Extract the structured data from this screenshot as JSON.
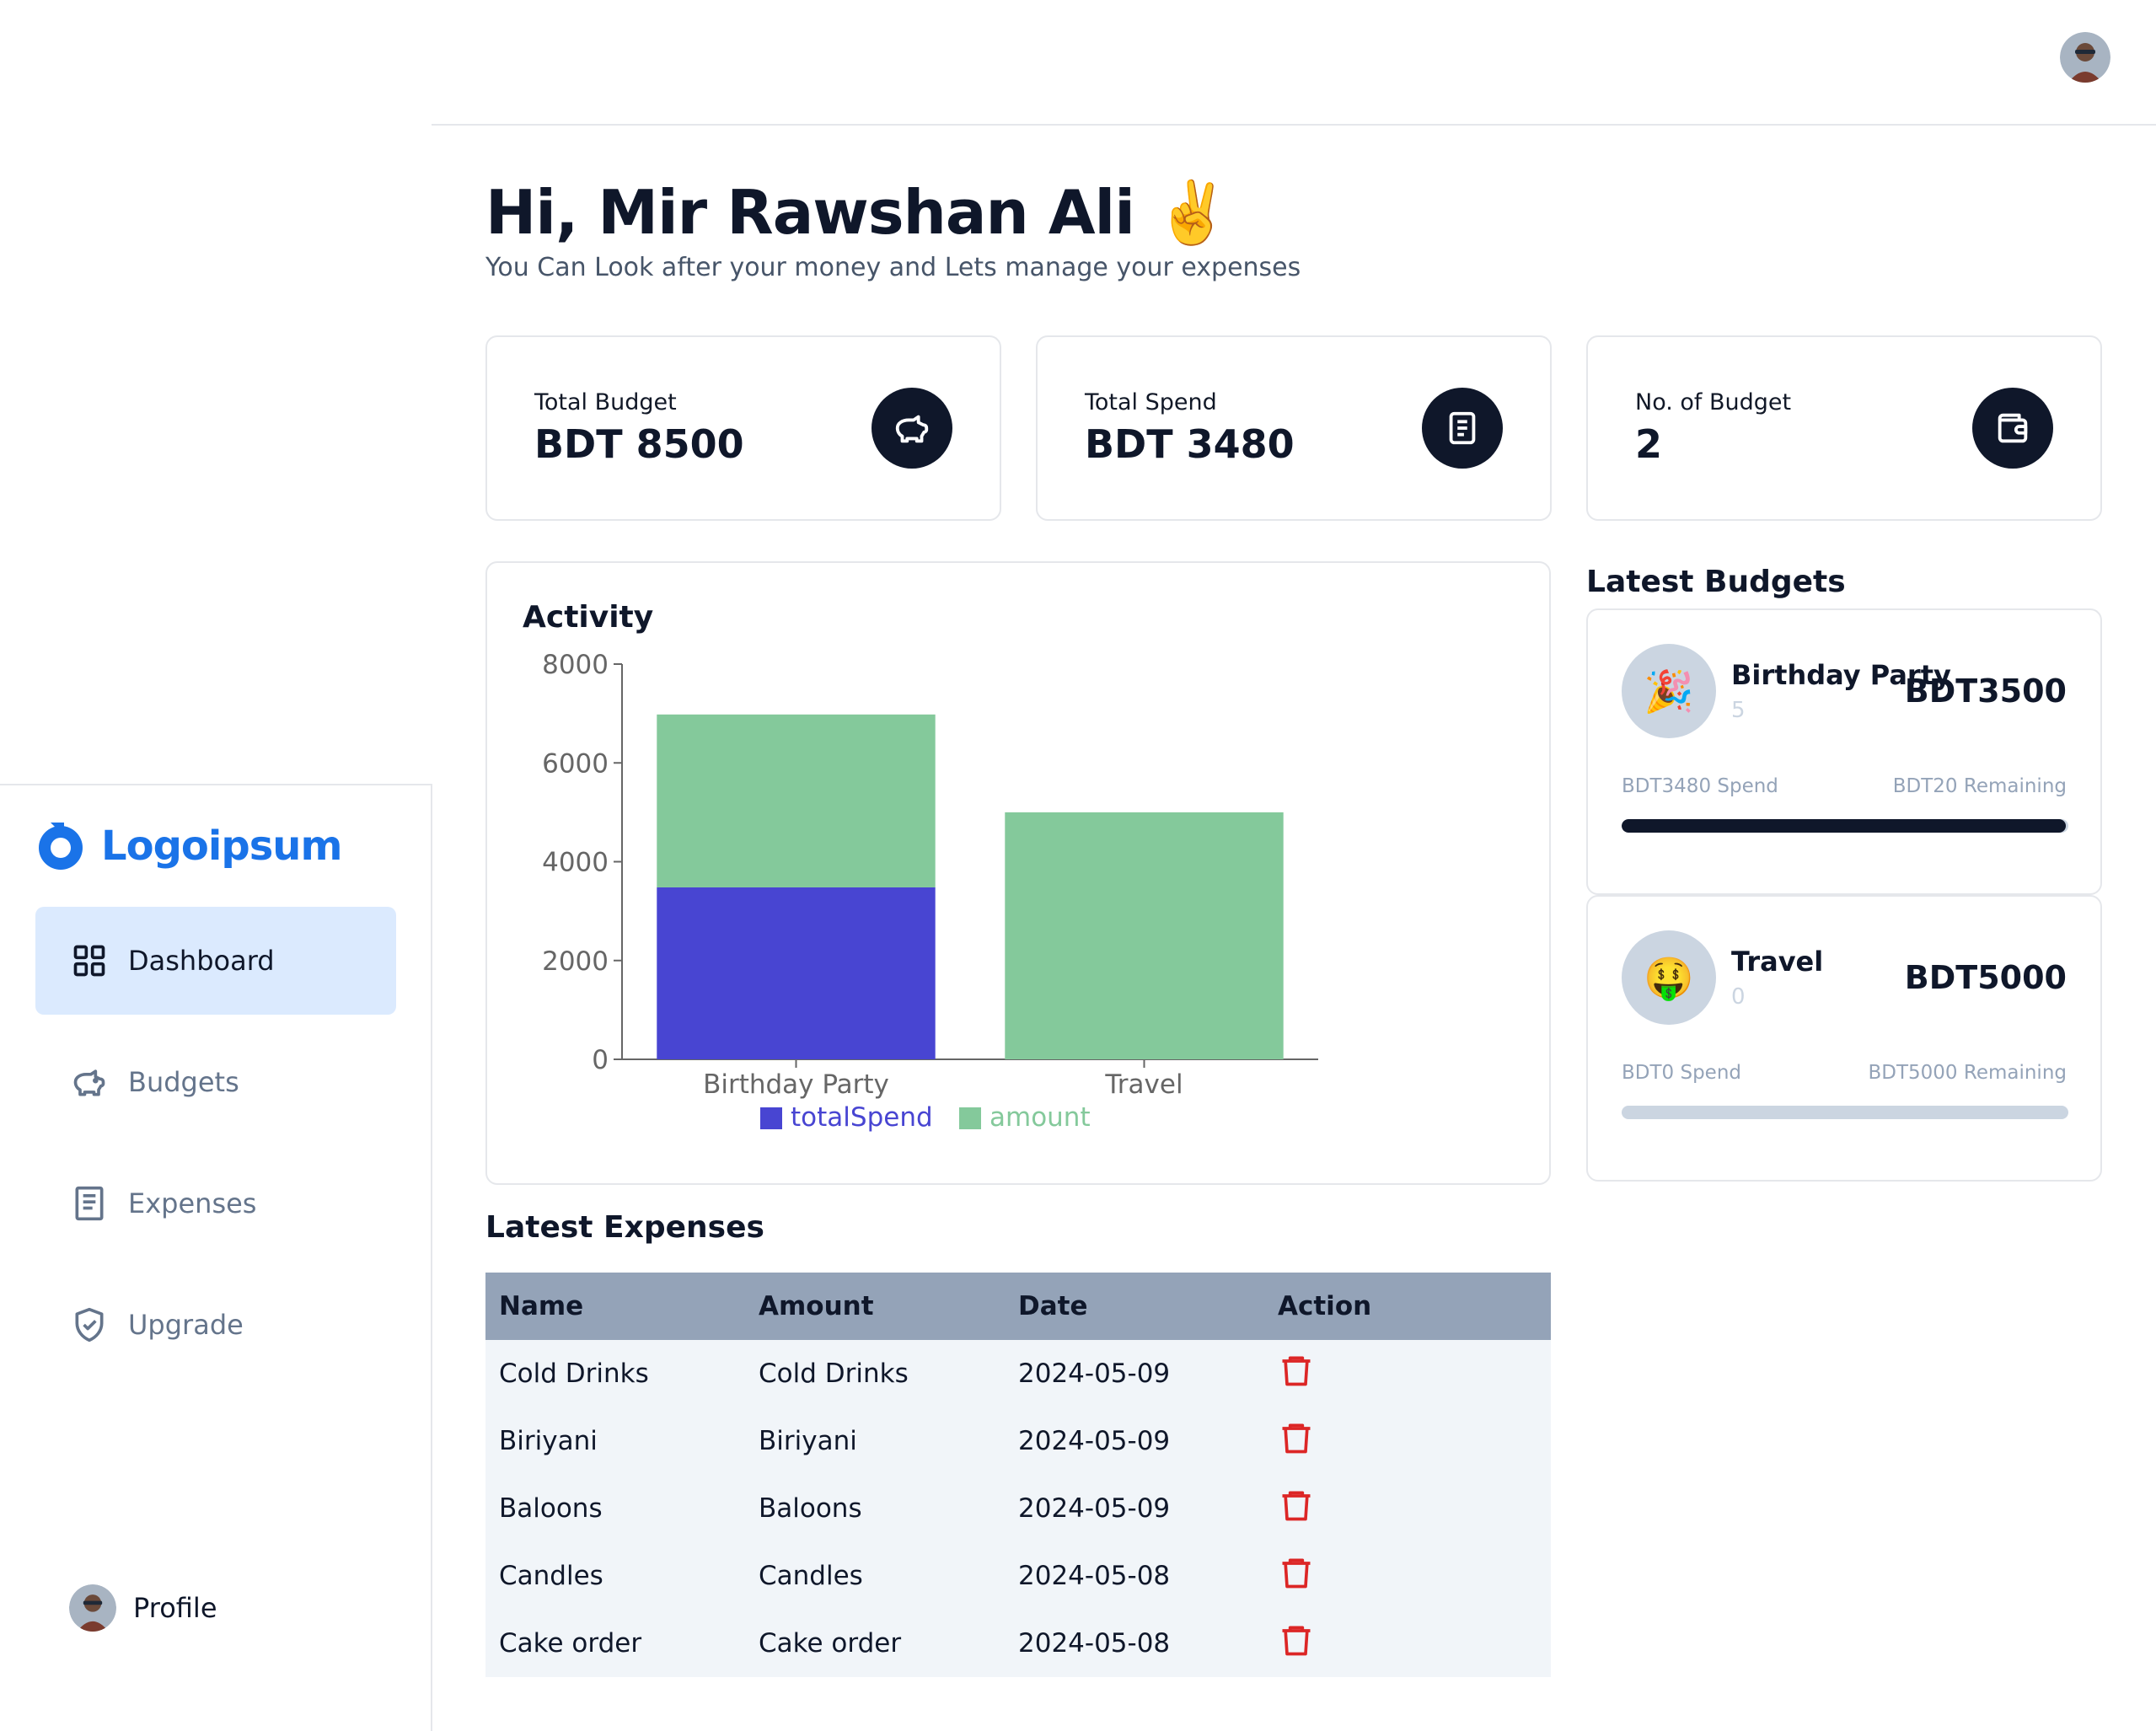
{
  "header": {
    "avatar_icon": "user-avatar"
  },
  "sidebar": {
    "logo_text": "Logoipsum",
    "brand_color": "#1a73e8",
    "items": [
      {
        "label": "Dashboard",
        "icon": "layout-grid-icon",
        "active": true
      },
      {
        "label": "Budgets",
        "icon": "piggy-bank-icon",
        "active": false
      },
      {
        "label": "Expenses",
        "icon": "receipt-icon",
        "active": false
      },
      {
        "label": "Upgrade",
        "icon": "shield-check-icon",
        "active": false
      }
    ],
    "profile_label": "Profile"
  },
  "main": {
    "greeting": "Hi, Mir Rawshan Ali ✌️",
    "subtitle": "You Can Look after your money and Lets manage your expenses",
    "cards": [
      {
        "label": "Total Budget",
        "value": "BDT 8500",
        "icon": "piggy-bank-icon"
      },
      {
        "label": "Total Spend",
        "value": "BDT 3480",
        "icon": "receipt-icon"
      },
      {
        "label": "No. of Budget",
        "value": "2",
        "icon": "wallet-icon"
      }
    ],
    "latest_budgets_title": "Latest Budgets",
    "latest_expenses_title": "Latest Expenses"
  },
  "chart_data": {
    "type": "bar",
    "stacked": true,
    "title": "Activity",
    "categories": [
      "Birthday Party",
      "Travel"
    ],
    "series": [
      {
        "name": "totalSpend",
        "values": [
          3480,
          0
        ],
        "color": "#4845d2"
      },
      {
        "name": "amount",
        "values": [
          3500,
          5000
        ],
        "color": "#84c99b"
      }
    ],
    "ylim": [
      0,
      8000
    ],
    "yticks": [
      "0",
      "2000",
      "4000",
      "6000",
      "8000"
    ],
    "legend": "bottom"
  },
  "budgets": [
    {
      "emoji": "🎉",
      "name": "Birthday Party",
      "count": "5",
      "amount": "BDT3500",
      "spend": "BDT3480 Spend",
      "remaining": "BDT20 Remaining",
      "progress": 0.994
    },
    {
      "emoji": "🤑",
      "name": "Travel",
      "count": "0",
      "amount": "BDT5000",
      "spend": "BDT0 Spend",
      "remaining": "BDT5000 Remaining",
      "progress": 0
    }
  ],
  "expenses": {
    "headers": [
      "Name",
      "Amount",
      "Date",
      "Action"
    ],
    "rows": [
      {
        "name": "Cold Drinks",
        "amount": "Cold Drinks",
        "date": "2024-05-09"
      },
      {
        "name": "Biriyani",
        "amount": "Biriyani",
        "date": "2024-05-09"
      },
      {
        "name": "Baloons",
        "amount": "Baloons",
        "date": "2024-05-09"
      },
      {
        "name": "Candles",
        "amount": "Candles",
        "date": "2024-05-08"
      },
      {
        "name": "Cake order",
        "amount": "Cake order",
        "date": "2024-05-08"
      }
    ],
    "delete_icon": "trash-icon",
    "delete_color": "#dc2626"
  }
}
